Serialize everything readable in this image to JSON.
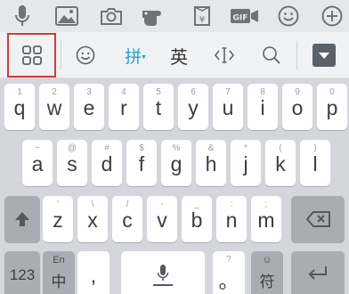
{
  "toolbar": {
    "icons": [
      "microphone-icon",
      "image-icon",
      "camera-icon",
      "hand-icon",
      "yen-icon",
      "gif-icon",
      "emoji-icon",
      "plus-icon"
    ],
    "gif_label": "GIF",
    "yen_label": "¥"
  },
  "funcbar": {
    "pinyin_label": "拼",
    "english_label": "英",
    "cursor_label": "⟨I⟩"
  },
  "keyboard": {
    "row1": [
      {
        "hint": "1",
        "label": "q"
      },
      {
        "hint": "2",
        "label": "w"
      },
      {
        "hint": "3",
        "label": "e"
      },
      {
        "hint": "4",
        "label": "r"
      },
      {
        "hint": "5",
        "label": "t"
      },
      {
        "hint": "6",
        "label": "y"
      },
      {
        "hint": "7",
        "label": "u"
      },
      {
        "hint": "8",
        "label": "i"
      },
      {
        "hint": "9",
        "label": "o"
      },
      {
        "hint": "0",
        "label": "p"
      }
    ],
    "row2": [
      {
        "hint": "~",
        "label": "a"
      },
      {
        "hint": "@",
        "label": "s"
      },
      {
        "hint": "#",
        "label": "d"
      },
      {
        "hint": "$",
        "label": "f"
      },
      {
        "hint": "%",
        "label": "g"
      },
      {
        "hint": "&",
        "label": "h"
      },
      {
        "hint": "*",
        "label": "j"
      },
      {
        "hint": "(",
        "label": "k"
      },
      {
        "hint": ")",
        "label": "l"
      }
    ],
    "row3": [
      {
        "hint": "'",
        "label": "z"
      },
      {
        "hint": "\\",
        "label": "x"
      },
      {
        "hint": "/",
        "label": "c"
      },
      {
        "hint": "-",
        "label": "v"
      },
      {
        "hint": "_",
        "label": "b"
      },
      {
        "hint": ":",
        "label": "n"
      },
      {
        "hint": ";",
        "label": "m"
      }
    ],
    "num_label": "123",
    "lang_hint": "En",
    "lang_label": "中",
    "comma_label": ",",
    "question_hint": "?",
    "period_label": "。",
    "symbol_hint": "☺",
    "symbol_label": "符"
  }
}
